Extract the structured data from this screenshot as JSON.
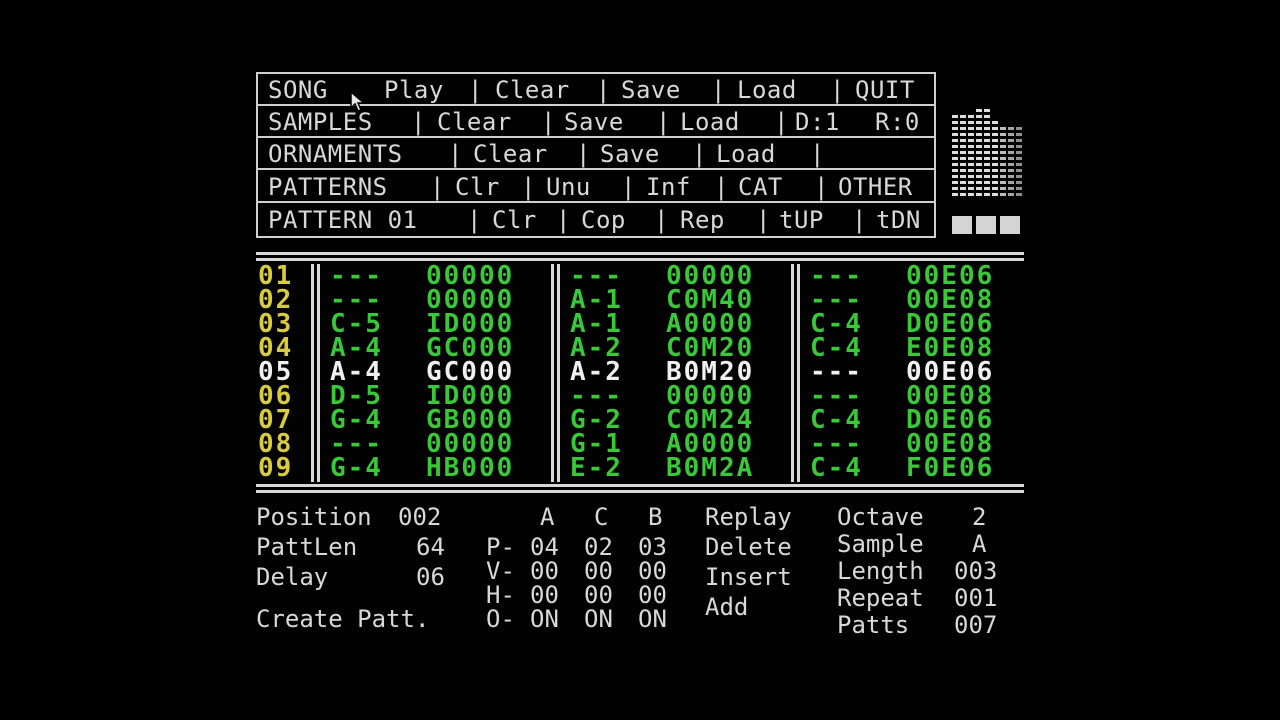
{
  "menu": {
    "song": {
      "label": "SONG",
      "play": "Play",
      "clear": "Clear",
      "save": "Save",
      "load": "Load",
      "quit": "QUIT"
    },
    "samples": {
      "label": "SAMPLES",
      "clear": "Clear",
      "save": "Save",
      "load": "Load",
      "d": "D:1",
      "r": "R:0"
    },
    "ornaments": {
      "label": "ORNAMENTS",
      "clear": "Clear",
      "save": "Save",
      "load": "Load"
    },
    "patterns": {
      "label": "PATTERNS",
      "clr": "Clr",
      "unu": "Unu",
      "inf": "Inf",
      "cat": "CAT",
      "other": "OTHER"
    },
    "pattern": {
      "label": "PATTERN 01",
      "clr": "Clr",
      "cop": "Cop",
      "rep": "Rep",
      "tup": "tUP",
      "tdn": "tDN"
    },
    "separator": "|"
  },
  "pattern_rows": [
    {
      "num": "01",
      "a_note": "---",
      "a_fx": "00000",
      "b_note": "---",
      "b_fx": "00000",
      "c_note": "---",
      "c_fx": "00E06"
    },
    {
      "num": "02",
      "a_note": "---",
      "a_fx": "00000",
      "b_note": "A-1",
      "b_fx": "C0M40",
      "c_note": "---",
      "c_fx": "00E08"
    },
    {
      "num": "03",
      "a_note": "C-5",
      "a_fx": "ID000",
      "b_note": "A-1",
      "b_fx": "A0000",
      "c_note": "C-4",
      "c_fx": "D0E06"
    },
    {
      "num": "04",
      "a_note": "A-4",
      "a_fx": "GC000",
      "b_note": "A-2",
      "b_fx": "C0M20",
      "c_note": "C-4",
      "c_fx": "E0E08"
    },
    {
      "num": "05",
      "a_note": "A-4",
      "a_fx": "GC000",
      "b_note": "A-2",
      "b_fx": "B0M20",
      "c_note": "---",
      "c_fx": "00E06"
    },
    {
      "num": "06",
      "a_note": "D-5",
      "a_fx": "ID000",
      "b_note": "---",
      "b_fx": "00000",
      "c_note": "---",
      "c_fx": "00E08"
    },
    {
      "num": "07",
      "a_note": "G-4",
      "a_fx": "GB000",
      "b_note": "G-2",
      "b_fx": "C0M24",
      "c_note": "C-4",
      "c_fx": "D0E06"
    },
    {
      "num": "08",
      "a_note": "---",
      "a_fx": "00000",
      "b_note": "G-1",
      "b_fx": "A0000",
      "c_note": "---",
      "c_fx": "00E08"
    },
    {
      "num": "09",
      "a_note": "G-4",
      "a_fx": "HB000",
      "b_note": "E-2",
      "b_fx": "B0M2A",
      "c_note": "C-4",
      "c_fx": "F0E06"
    }
  ],
  "selected_row": 5,
  "status": {
    "position_label": "Position",
    "position_value": "002",
    "pattlen_label": "PattLen",
    "pattlen_value": "64",
    "delay_label": "Delay",
    "delay_value": "06",
    "create_patt": "Create Patt.",
    "channel_header": [
      "A",
      "C",
      "B"
    ],
    "p_row": {
      "label": "P-",
      "values": [
        "04",
        "02",
        "03"
      ]
    },
    "v_row": {
      "label": "V-",
      "values": [
        "00",
        "00",
        "00"
      ]
    },
    "h_row": {
      "label": "H-",
      "values": [
        "00",
        "00",
        "00"
      ]
    },
    "o_row": {
      "label": "O-",
      "values": [
        "ON",
        "ON",
        "ON"
      ]
    },
    "replay": "Replay",
    "delete": "Delete",
    "insert": "Insert",
    "add": "Add",
    "octave_label": "Octave",
    "octave_value": "2",
    "sample_label": "Sample",
    "sample_value": "A",
    "length_label": "Length",
    "length_value": "003",
    "repeat_label": "Repeat",
    "repeat_value": "001",
    "patts_label": "Patts",
    "patts_value": "007"
  },
  "colors": {
    "row_number": "#d8cc3c",
    "data": "#38c838",
    "highlight": "#f0f0f0",
    "text": "#d8d8d8"
  },
  "icons": {
    "cursor": "mouse-pointer-icon",
    "meter": "level-meter-icon",
    "blocks": "channel-indicator-icon"
  }
}
